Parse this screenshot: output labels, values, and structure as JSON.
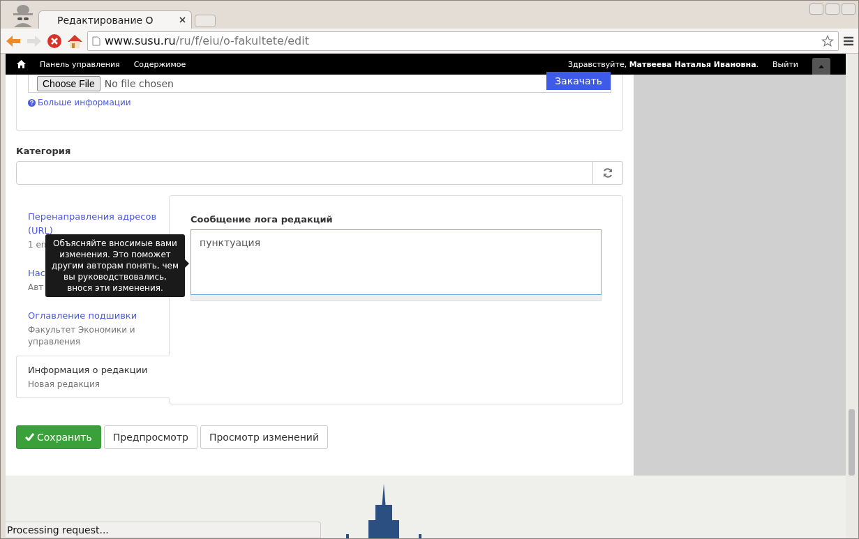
{
  "browser": {
    "tab_title": "Редактирование О",
    "url_host": "www.susu.ru",
    "url_path": "/ru/f/eiu/o-fakultete/edit"
  },
  "admin_bar": {
    "items": [
      "Панель управления",
      "Содержимое"
    ],
    "greeting": "Здравствуйте, **Матвеева Наталья Ивановна**.",
    "logout": "Выйти"
  },
  "upload": {
    "button": "Choose File",
    "status": "No file chosen",
    "submit": "Закачать",
    "help_link": "Больше информации"
  },
  "category": {
    "label": "Категория"
  },
  "vertical_tabs": [
    {
      "title": "Перенаправления адресов (URL)",
      "summary": "1 en",
      "selected": false
    },
    {
      "title": "Нас",
      "summary": "Авт",
      "selected": false
    },
    {
      "title": "Оглавление подшивки",
      "summary": "Факультет Экономики и управления",
      "selected": false
    },
    {
      "title": "Информация о редакции",
      "summary": "Новая редакция",
      "selected": true
    }
  ],
  "revision": {
    "label": "Сообщение лога редакций",
    "value": "пунктуация"
  },
  "tooltip": "Объясняйте вносимые вами изменения. Это поможет другим авторам понять, чем вы руководствовались, внося эти изменения.",
  "actions": [
    {
      "label": "Сохранить",
      "kind": "primary"
    },
    {
      "label": "Предпросмотр",
      "kind": "default"
    },
    {
      "label": "Просмотр изменений",
      "kind": "default"
    }
  ],
  "status_bar": "Processing request..."
}
